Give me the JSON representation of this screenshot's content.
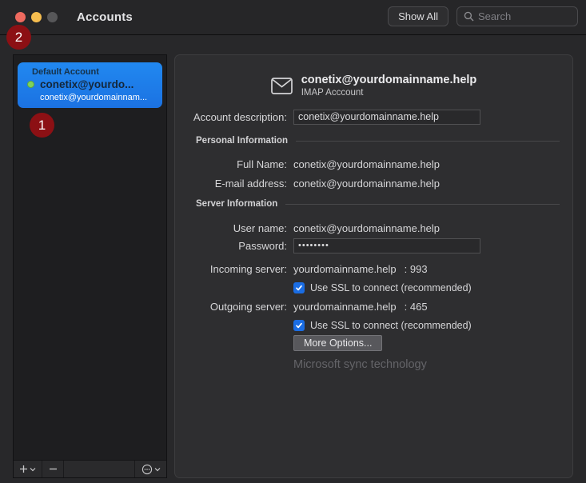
{
  "window": {
    "title": "Accounts"
  },
  "titlebar": {
    "show_all_label": "Show All",
    "search_placeholder": "Search"
  },
  "annotations": {
    "badge1": "1",
    "badge2": "2",
    "badge_color": "#8c1014"
  },
  "sidebar": {
    "group_label": "Default Account",
    "account_name": "conetix@yourdo...",
    "account_subtitle": "conetix@yourdomainnam...",
    "selected_color": "#1e7de8",
    "status_dot_color": "#7fd35b"
  },
  "main": {
    "header": {
      "title": "conetix@yourdomainname.help",
      "subtitle": "IMAP Acccount"
    },
    "account_description": {
      "label": "Account description:",
      "value": "conetix@yourdomainname.help"
    },
    "sections": {
      "personal": "Personal Information",
      "server": "Server Information"
    },
    "fields": {
      "full_name": {
        "label": "Full Name:",
        "value": "conetix@yourdomainname.help"
      },
      "email": {
        "label": "E-mail address:",
        "value": "conetix@yourdomainname.help"
      },
      "user_name": {
        "label": "User name:",
        "value": "conetix@yourdomainname.help"
      },
      "password": {
        "label": "Password:",
        "value": "••••••••"
      },
      "incoming": {
        "label": "Incoming server:",
        "value": "yourdomainname.help",
        "port": ": 993"
      },
      "outgoing": {
        "label": "Outgoing server:",
        "value": "yourdomainname.help",
        "port": ": 465"
      }
    },
    "ssl_label": "Use SSL to connect (recommended)",
    "more_options_label": "More Options...",
    "footnote": "Microsoft sync technology",
    "checkbox_color": "#1a6de4"
  }
}
